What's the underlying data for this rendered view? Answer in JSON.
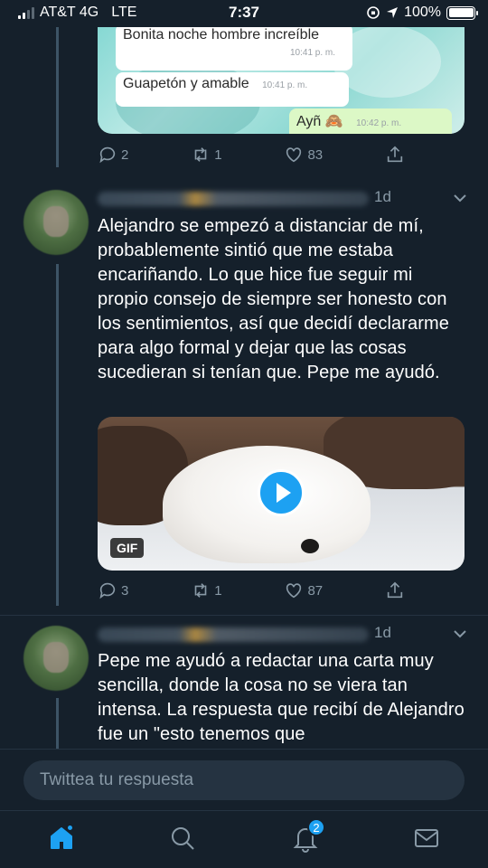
{
  "status_bar": {
    "carrier": "AT&T 4G",
    "network": "LTE",
    "time": "7:37",
    "battery": "100%"
  },
  "tweets": [
    {
      "image_chat": {
        "messages": [
          {
            "text": "Bonita noche hombre increíble",
            "time": "10:41 p. m."
          },
          {
            "text": "Guapetón y amable",
            "time": "10:41 p. m."
          },
          {
            "text": "Ayñ",
            "time": "10:42 p. m."
          }
        ]
      },
      "actions": {
        "replies": "2",
        "retweets": "1",
        "likes": "83"
      }
    },
    {
      "time": "1d",
      "text": "Alejandro se empezó a distanciar de mí, probablemente sintió que me estaba encariñando. Lo que hice fue seguir mi propio consejo de siempre ser honesto con los sentimientos, así que decidí declararme para algo formal y dejar que las cosas sucedieran si tenían que. Pepe me ayudó.",
      "media": {
        "type": "gif",
        "badge": "GIF"
      },
      "actions": {
        "replies": "3",
        "retweets": "1",
        "likes": "87"
      }
    },
    {
      "time": "1d",
      "text": "Pepe me ayudó a redactar una carta muy sencilla, donde la cosa no se viera tan intensa. La respuesta que recibí de Alejandro fue un \"esto tenemos que"
    }
  ],
  "reply_box": {
    "placeholder": "Twittea tu respuesta"
  },
  "tab_bar": {
    "items": [
      {
        "icon": "home-icon",
        "active": true
      },
      {
        "icon": "search-icon"
      },
      {
        "icon": "bell-icon",
        "badge": "2"
      },
      {
        "icon": "mail-icon"
      }
    ]
  },
  "colors": {
    "background": "#15202b",
    "accent": "#1da1f2",
    "muted": "#8899a6"
  }
}
